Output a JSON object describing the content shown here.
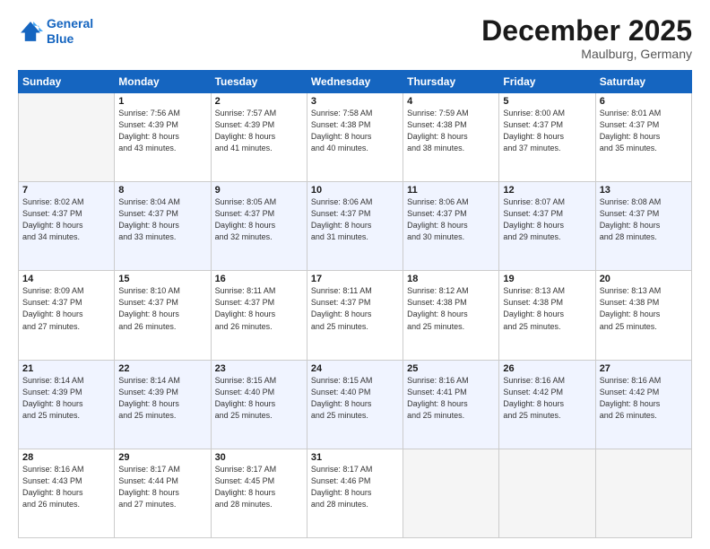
{
  "header": {
    "logo_line1": "General",
    "logo_line2": "Blue",
    "month": "December 2025",
    "location": "Maulburg, Germany"
  },
  "weekdays": [
    "Sunday",
    "Monday",
    "Tuesday",
    "Wednesday",
    "Thursday",
    "Friday",
    "Saturday"
  ],
  "rows": [
    [
      {
        "day": "",
        "info": ""
      },
      {
        "day": "1",
        "info": "Sunrise: 7:56 AM\nSunset: 4:39 PM\nDaylight: 8 hours\nand 43 minutes."
      },
      {
        "day": "2",
        "info": "Sunrise: 7:57 AM\nSunset: 4:39 PM\nDaylight: 8 hours\nand 41 minutes."
      },
      {
        "day": "3",
        "info": "Sunrise: 7:58 AM\nSunset: 4:38 PM\nDaylight: 8 hours\nand 40 minutes."
      },
      {
        "day": "4",
        "info": "Sunrise: 7:59 AM\nSunset: 4:38 PM\nDaylight: 8 hours\nand 38 minutes."
      },
      {
        "day": "5",
        "info": "Sunrise: 8:00 AM\nSunset: 4:37 PM\nDaylight: 8 hours\nand 37 minutes."
      },
      {
        "day": "6",
        "info": "Sunrise: 8:01 AM\nSunset: 4:37 PM\nDaylight: 8 hours\nand 35 minutes."
      }
    ],
    [
      {
        "day": "7",
        "info": "Sunrise: 8:02 AM\nSunset: 4:37 PM\nDaylight: 8 hours\nand 34 minutes."
      },
      {
        "day": "8",
        "info": "Sunrise: 8:04 AM\nSunset: 4:37 PM\nDaylight: 8 hours\nand 33 minutes."
      },
      {
        "day": "9",
        "info": "Sunrise: 8:05 AM\nSunset: 4:37 PM\nDaylight: 8 hours\nand 32 minutes."
      },
      {
        "day": "10",
        "info": "Sunrise: 8:06 AM\nSunset: 4:37 PM\nDaylight: 8 hours\nand 31 minutes."
      },
      {
        "day": "11",
        "info": "Sunrise: 8:06 AM\nSunset: 4:37 PM\nDaylight: 8 hours\nand 30 minutes."
      },
      {
        "day": "12",
        "info": "Sunrise: 8:07 AM\nSunset: 4:37 PM\nDaylight: 8 hours\nand 29 minutes."
      },
      {
        "day": "13",
        "info": "Sunrise: 8:08 AM\nSunset: 4:37 PM\nDaylight: 8 hours\nand 28 minutes."
      }
    ],
    [
      {
        "day": "14",
        "info": "Sunrise: 8:09 AM\nSunset: 4:37 PM\nDaylight: 8 hours\nand 27 minutes."
      },
      {
        "day": "15",
        "info": "Sunrise: 8:10 AM\nSunset: 4:37 PM\nDaylight: 8 hours\nand 26 minutes."
      },
      {
        "day": "16",
        "info": "Sunrise: 8:11 AM\nSunset: 4:37 PM\nDaylight: 8 hours\nand 26 minutes."
      },
      {
        "day": "17",
        "info": "Sunrise: 8:11 AM\nSunset: 4:37 PM\nDaylight: 8 hours\nand 25 minutes."
      },
      {
        "day": "18",
        "info": "Sunrise: 8:12 AM\nSunset: 4:38 PM\nDaylight: 8 hours\nand 25 minutes."
      },
      {
        "day": "19",
        "info": "Sunrise: 8:13 AM\nSunset: 4:38 PM\nDaylight: 8 hours\nand 25 minutes."
      },
      {
        "day": "20",
        "info": "Sunrise: 8:13 AM\nSunset: 4:38 PM\nDaylight: 8 hours\nand 25 minutes."
      }
    ],
    [
      {
        "day": "21",
        "info": "Sunrise: 8:14 AM\nSunset: 4:39 PM\nDaylight: 8 hours\nand 25 minutes."
      },
      {
        "day": "22",
        "info": "Sunrise: 8:14 AM\nSunset: 4:39 PM\nDaylight: 8 hours\nand 25 minutes."
      },
      {
        "day": "23",
        "info": "Sunrise: 8:15 AM\nSunset: 4:40 PM\nDaylight: 8 hours\nand 25 minutes."
      },
      {
        "day": "24",
        "info": "Sunrise: 8:15 AM\nSunset: 4:40 PM\nDaylight: 8 hours\nand 25 minutes."
      },
      {
        "day": "25",
        "info": "Sunrise: 8:16 AM\nSunset: 4:41 PM\nDaylight: 8 hours\nand 25 minutes."
      },
      {
        "day": "26",
        "info": "Sunrise: 8:16 AM\nSunset: 4:42 PM\nDaylight: 8 hours\nand 25 minutes."
      },
      {
        "day": "27",
        "info": "Sunrise: 8:16 AM\nSunset: 4:42 PM\nDaylight: 8 hours\nand 26 minutes."
      }
    ],
    [
      {
        "day": "28",
        "info": "Sunrise: 8:16 AM\nSunset: 4:43 PM\nDaylight: 8 hours\nand 26 minutes."
      },
      {
        "day": "29",
        "info": "Sunrise: 8:17 AM\nSunset: 4:44 PM\nDaylight: 8 hours\nand 27 minutes."
      },
      {
        "day": "30",
        "info": "Sunrise: 8:17 AM\nSunset: 4:45 PM\nDaylight: 8 hours\nand 28 minutes."
      },
      {
        "day": "31",
        "info": "Sunrise: 8:17 AM\nSunset: 4:46 PM\nDaylight: 8 hours\nand 28 minutes."
      },
      {
        "day": "",
        "info": ""
      },
      {
        "day": "",
        "info": ""
      },
      {
        "day": "",
        "info": ""
      }
    ]
  ]
}
